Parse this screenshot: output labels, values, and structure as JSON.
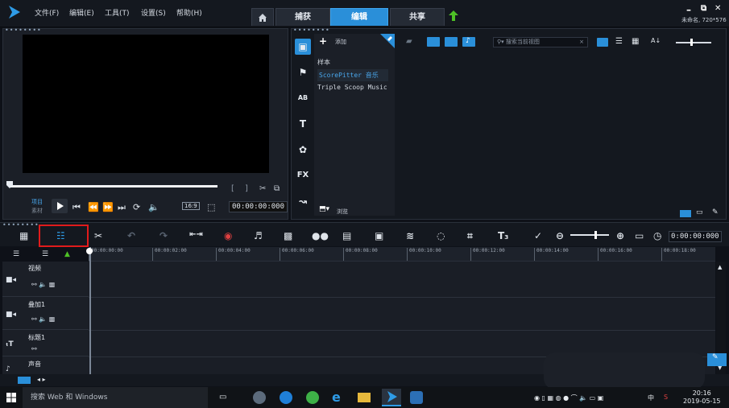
{
  "menu": [
    "文件(F)",
    "编辑(E)",
    "工具(T)",
    "设置(S)",
    "帮助(H)"
  ],
  "tabs": {
    "capture": "捕获",
    "edit": "编辑",
    "share": "共享"
  },
  "window": {
    "minimize": "–",
    "restore": "⧉",
    "close": "✕",
    "project_info": "未命名, 720*576"
  },
  "player": {
    "mode_project": "项目",
    "mode_clip": "素材",
    "aspect": "16:9",
    "timecode": "00:00:00:000"
  },
  "library": {
    "add_label": "添加",
    "items": [
      "样本",
      "ScorePitter 音乐",
      "Triple Scoop Music"
    ],
    "browse_label": "浏览",
    "search_placeholder": "搜索当前视图",
    "sort_label": "A↓"
  },
  "timeline": {
    "timecode": "0:00:00:000",
    "ruler": [
      "00:00:00:00",
      "00:00:02:00",
      "00:00:04:00",
      "00:00:06:00",
      "00:00:08:00",
      "00:00:10:00",
      "00:00:12:00",
      "00:00:14:00",
      "00:00:16:00",
      "00:00:18:00"
    ],
    "tracks": [
      "视频",
      "叠加1",
      "标题1",
      "声音"
    ],
    "fx_label": "FX"
  },
  "taskbar": {
    "search": "搜索 Web 和 Windows",
    "time": "20:16",
    "date": "2019-05-15",
    "ime": "中"
  },
  "colors": {
    "accent": "#2a8fd9",
    "highlight": "#e11b1b",
    "selected_text": "#49a7ec"
  }
}
